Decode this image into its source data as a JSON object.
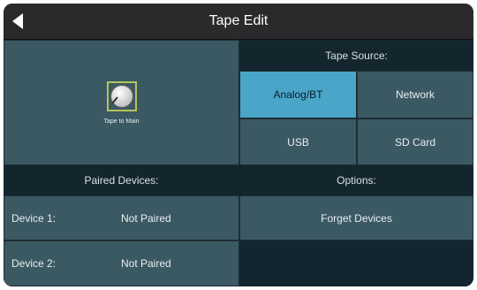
{
  "window": {
    "title": "Tape Edit"
  },
  "knob": {
    "label": "Tape to Main"
  },
  "tape_source": {
    "header": "Tape Source:",
    "options": [
      "Analog/BT",
      "Network",
      "USB",
      "SD Card"
    ],
    "selected": "Analog/BT"
  },
  "paired_devices": {
    "header": "Paired Devices:",
    "devices": [
      {
        "label": "Device 1:",
        "status": "Not Paired"
      },
      {
        "label": "Device 2:",
        "status": "Not Paired"
      }
    ]
  },
  "options": {
    "header": "Options:",
    "forget_label": "Forget Devices"
  },
  "colors": {
    "accent": "#4aa6c8",
    "panel": "#3b5963",
    "header": "#13262d"
  }
}
